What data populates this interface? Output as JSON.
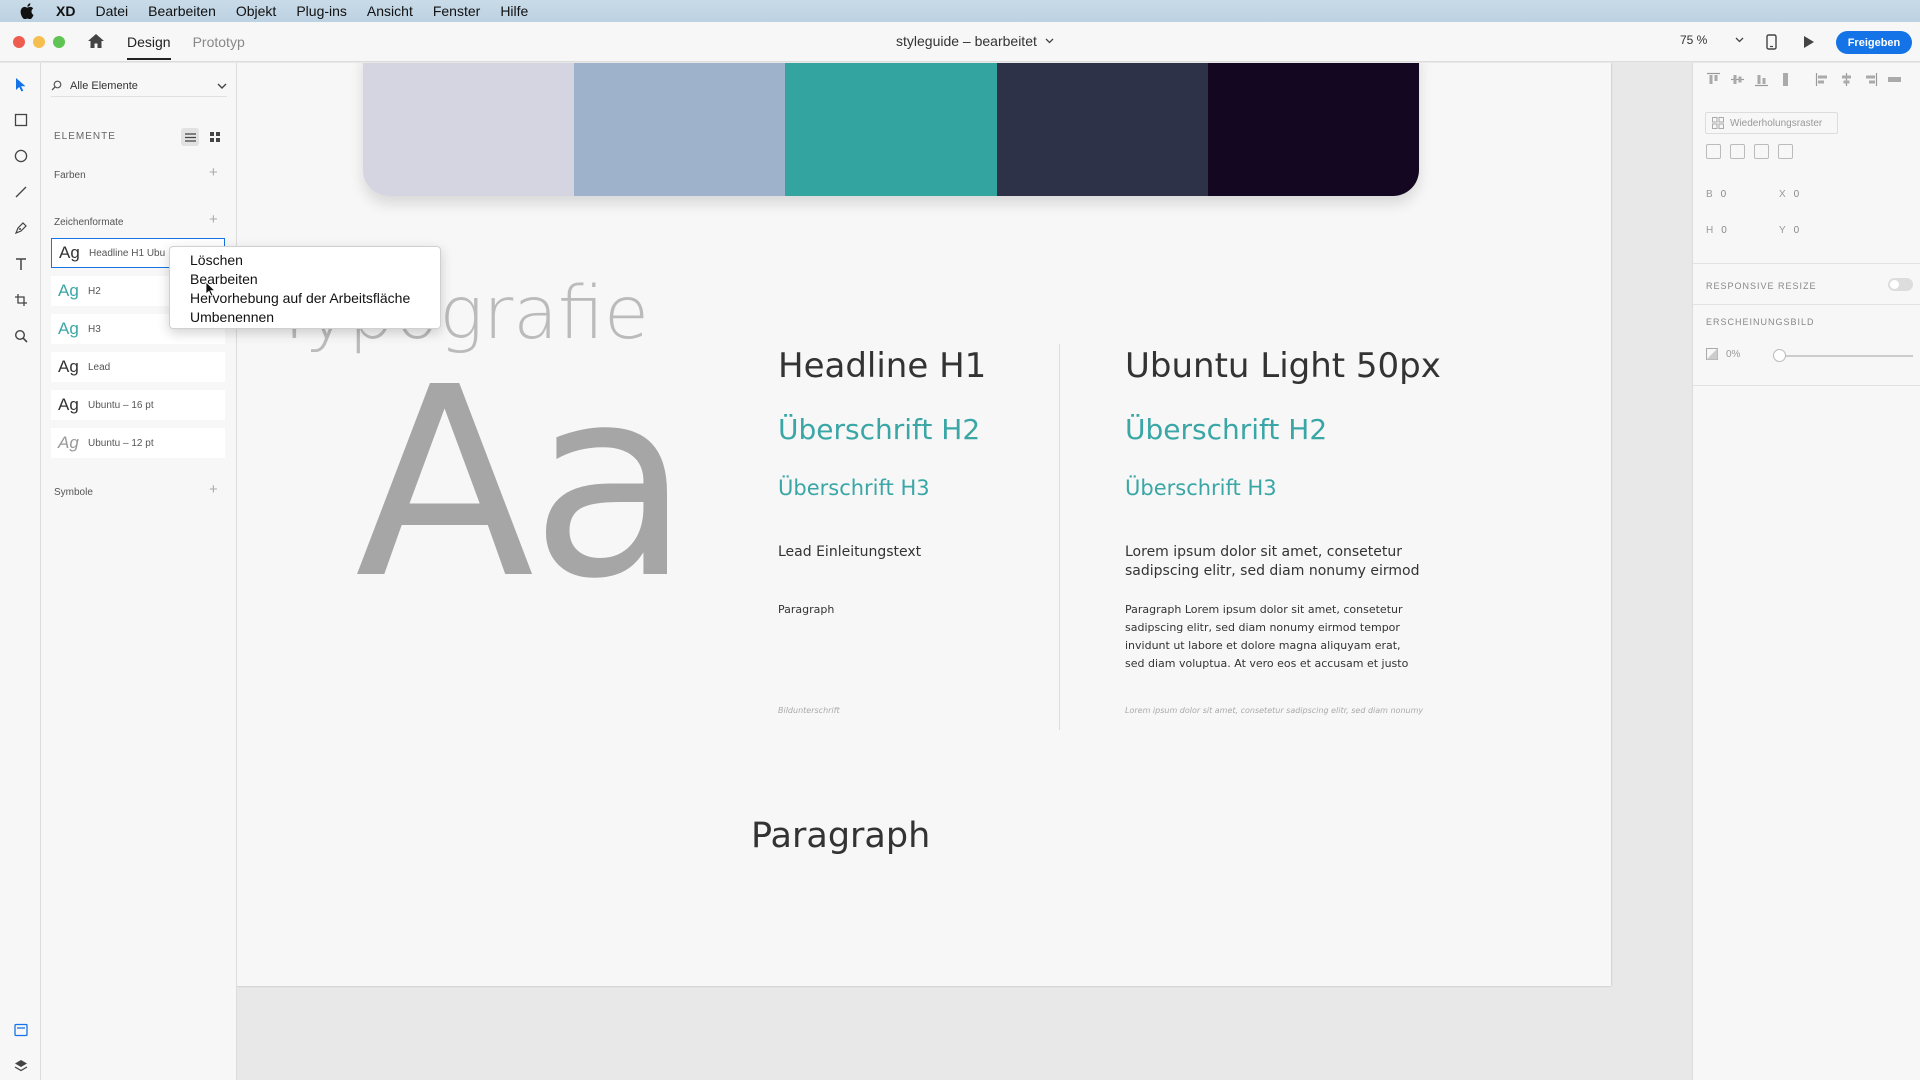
{
  "menubar": {
    "app_name": "XD",
    "items": [
      "Datei",
      "Bearbeiten",
      "Objekt",
      "Plug-ins",
      "Ansicht",
      "Fenster",
      "Hilfe"
    ]
  },
  "titlebar": {
    "mode_tabs": [
      "Design",
      "Prototyp"
    ],
    "active_tab": "Design",
    "document_title": "styleguide – bearbeitet",
    "zoom": "75 %",
    "share_label": "Freigeben"
  },
  "assets": {
    "filter_label": "Alle Elemente",
    "heading": "ELEMENTE",
    "colors_label": "Farben",
    "char_styles_label": "Zeichenformate",
    "symbols_label": "Symbole",
    "char_styles": [
      {
        "ag": "Ag",
        "name": "Headline H1 Ubu",
        "color": "#333333",
        "italic": false
      },
      {
        "ag": "Ag",
        "name": "H2",
        "color": "#3aa6a6",
        "italic": false
      },
      {
        "ag": "Ag",
        "name": "H3",
        "color": "#3aa6a6",
        "italic": false
      },
      {
        "ag": "Ag",
        "name": "Lead",
        "color": "#333333",
        "italic": false
      },
      {
        "ag": "Ag",
        "name": "Ubuntu – 16 pt",
        "color": "#333333",
        "italic": false
      },
      {
        "ag": "Ag",
        "name": "Ubuntu – 12 pt",
        "color": "#999999",
        "italic": true
      }
    ]
  },
  "context_menu": {
    "items": [
      "Löschen",
      "Bearbeiten",
      "Hervorhebung auf der Arbeitsfläche",
      "Umbenennen"
    ]
  },
  "artboard": {
    "swatch_colors": [
      "#d4d5e1",
      "#9eb2cb",
      "#34a4a1",
      "#2e3248",
      "#140722"
    ],
    "typography_heading": "Typografie",
    "specimen": "Aa",
    "left_column": {
      "h1": "Headline H1",
      "h2": "Überschrift H2",
      "h3": "Überschrift H3",
      "lead": "Lead Einleitungstext",
      "paragraph": "Paragraph",
      "caption": "Bildunterschrift"
    },
    "right_column": {
      "h1": "Ubuntu Light 50px",
      "h2": "Überschrift H2",
      "h3": "Überschrift H3",
      "lead_line1": "Lorem ipsum dolor sit amet, consetetur",
      "lead_line2": "sadipscing elitr, sed diam nonumy eirmod",
      "para_line1": "Paragraph Lorem ipsum dolor sit amet, consetetur",
      "para_line2": "sadipscing elitr, sed diam nonumy eirmod tempor",
      "para_line3": "invidunt ut labore et dolore magna aliquyam erat,",
      "para_line4": "sed diam voluptua. At vero eos et accusam et justo",
      "caption": "Lorem ipsum dolor sit amet, consetetur sadipscing elitr, sed diam nonumy"
    },
    "paragraph_heading": "Paragraph"
  },
  "properties": {
    "repeat_grid_label": "Wiederholungsraster",
    "width_label": "B",
    "width_value": "0",
    "height_label": "H",
    "height_value": "0",
    "x_label": "X",
    "x_value": "0",
    "y_label": "Y",
    "y_value": "0",
    "responsive_resize_label": "RESPONSIVE RESIZE",
    "appearance_label": "ERSCHEINUNGSBILD",
    "opacity_value": "0%"
  },
  "colors": {
    "accent": "#1473e6",
    "teal": "#3aa6a6",
    "dark_text": "#333333"
  }
}
